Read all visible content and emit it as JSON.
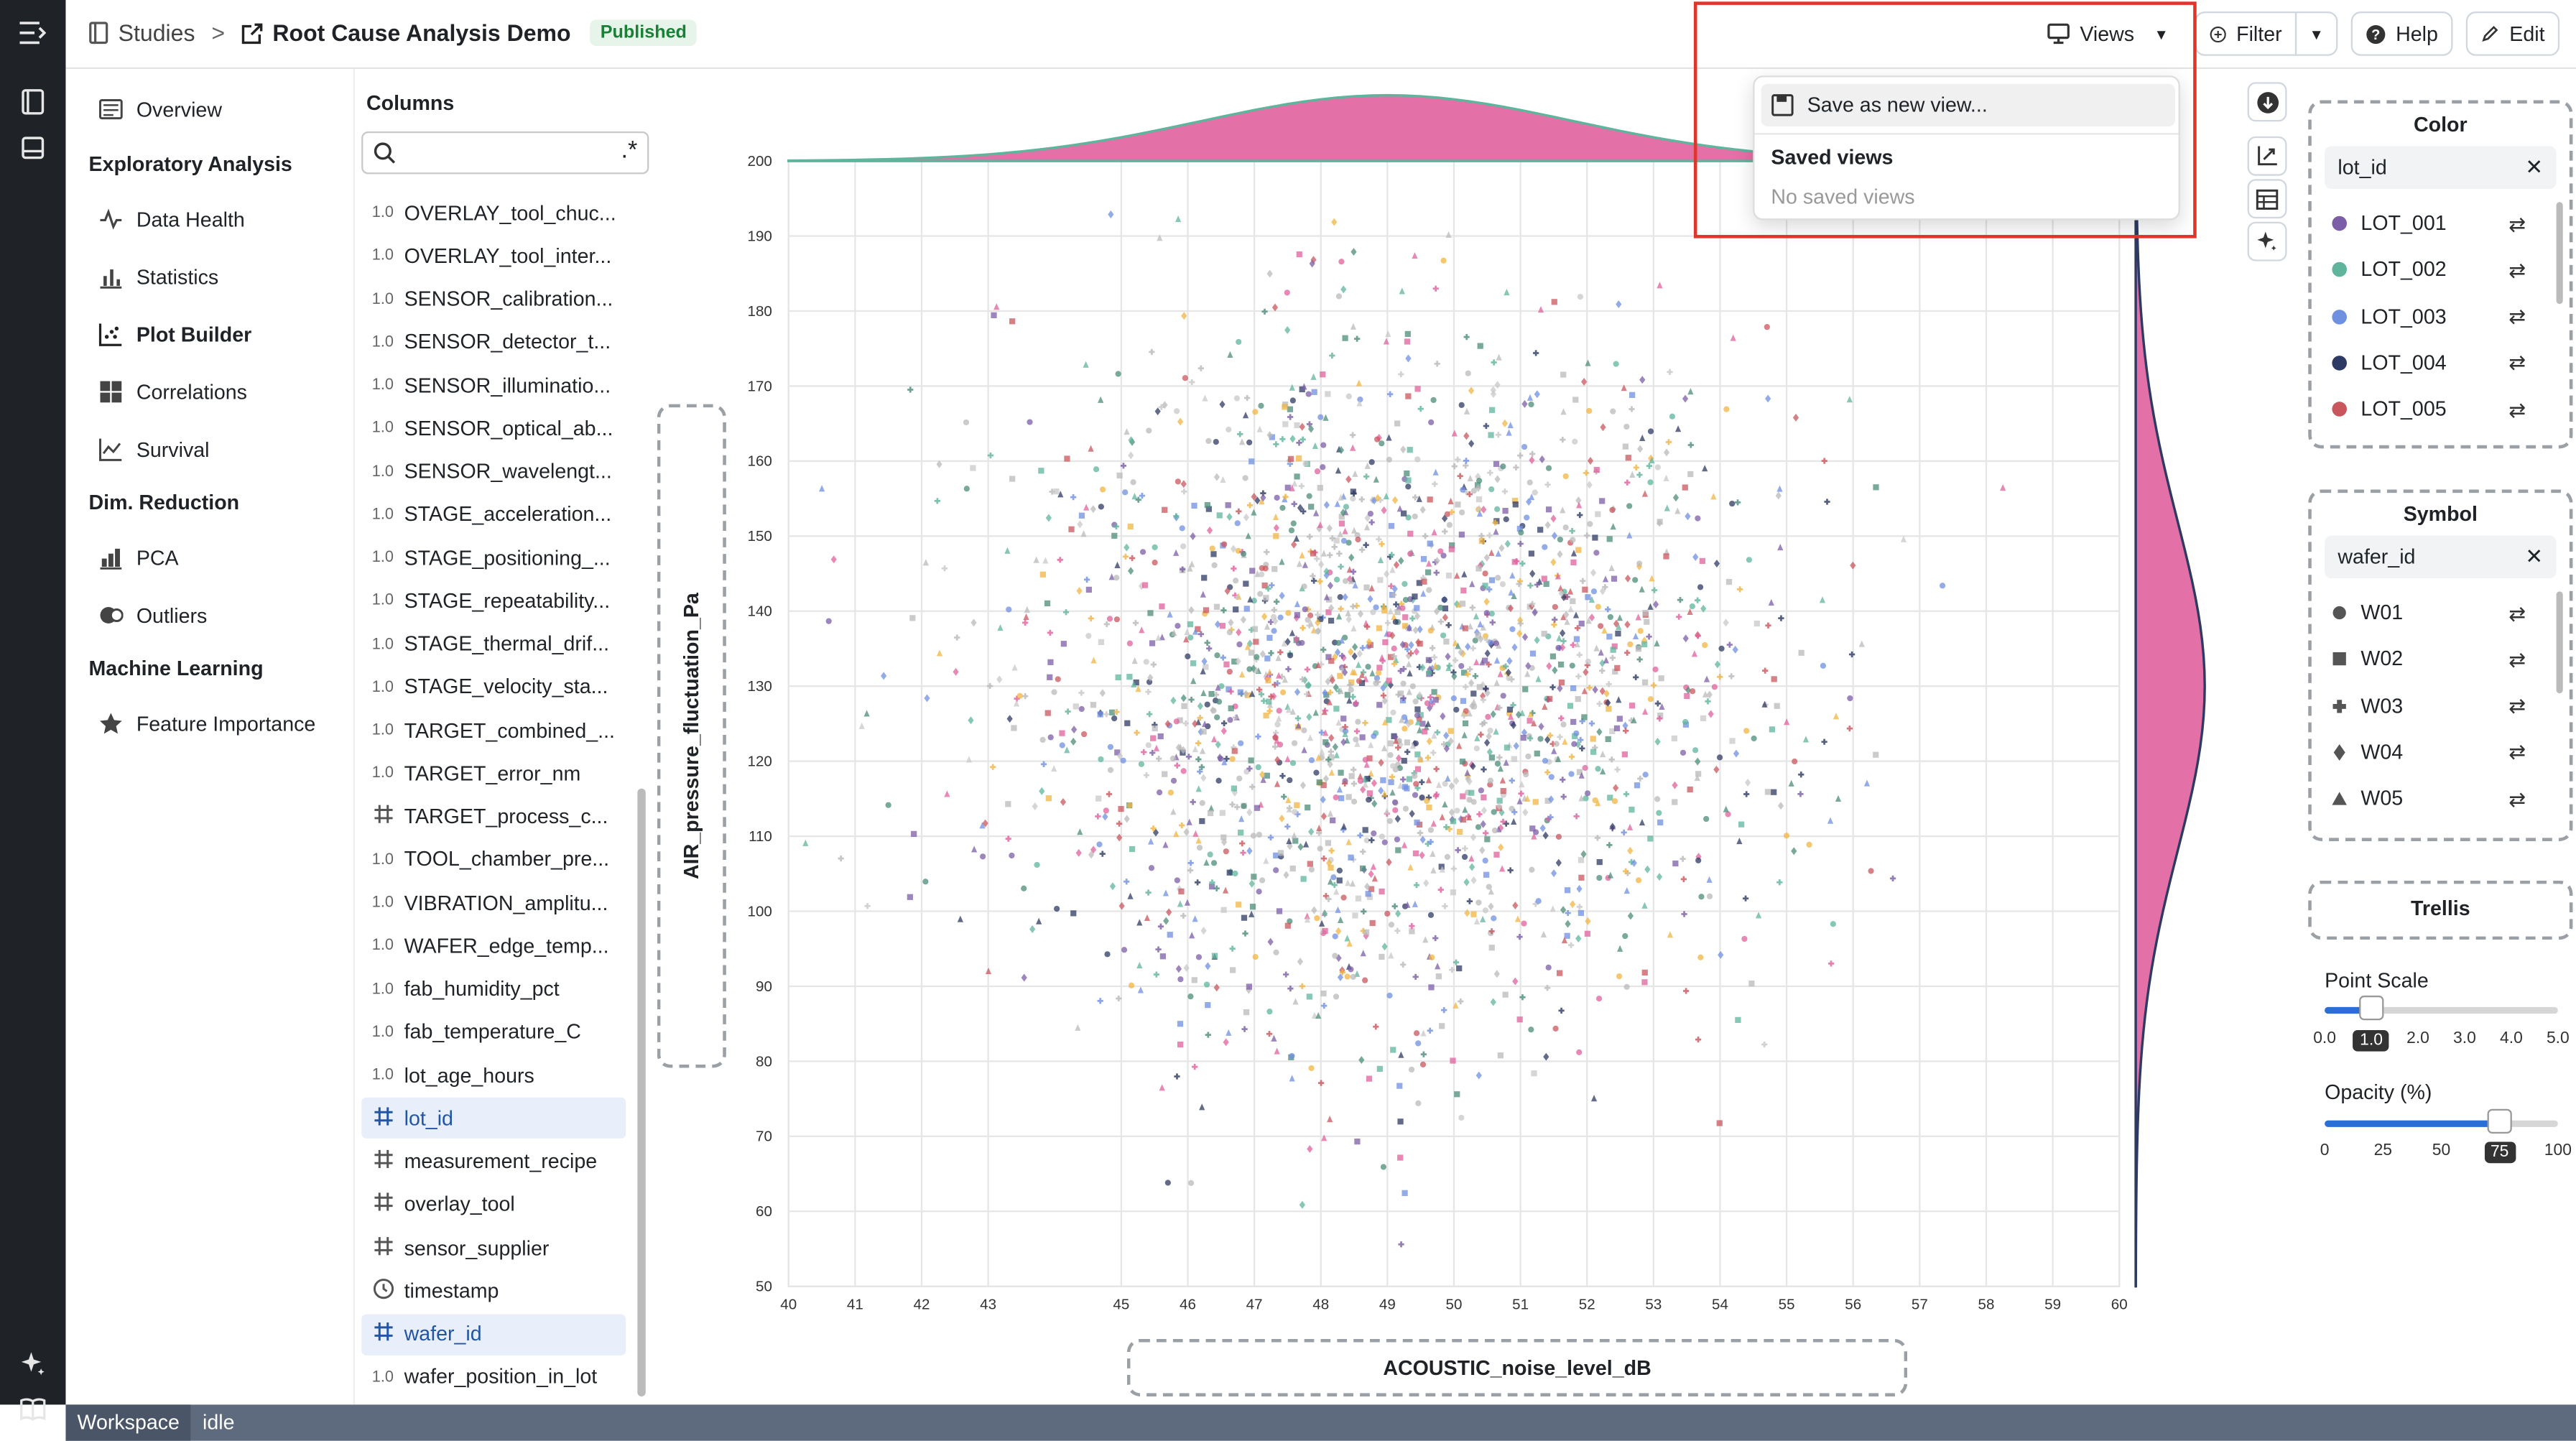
{
  "breadcrumb": {
    "studies": "Studies",
    "separator": ">",
    "title": "Root Cause Analysis Demo",
    "badge": "Published"
  },
  "toolbar": {
    "views": "Views",
    "filter": "Filter",
    "help": "Help",
    "edit": "Edit"
  },
  "views_menu": {
    "save_new": "Save as new view...",
    "saved_header": "Saved views",
    "empty": "No saved views"
  },
  "nav": {
    "overview": "Overview",
    "sec_exploratory": "Exploratory Analysis",
    "data_health": "Data Health",
    "statistics": "Statistics",
    "plot_builder": "Plot Builder",
    "correlations": "Correlations",
    "survival": "Survival",
    "sec_dim": "Dim. Reduction",
    "pca": "PCA",
    "outliers": "Outliers",
    "sec_ml": "Machine Learning",
    "feature_importance": "Feature Importance"
  },
  "columns": {
    "title": "Columns",
    "search_placeholder": "",
    "items": [
      {
        "type": "1.0",
        "label": "OVERLAY_tool_chuc..."
      },
      {
        "type": "1.0",
        "label": "OVERLAY_tool_inter..."
      },
      {
        "type": "1.0",
        "label": "SENSOR_calibration..."
      },
      {
        "type": "1.0",
        "label": "SENSOR_detector_t..."
      },
      {
        "type": "1.0",
        "label": "SENSOR_illuminatio..."
      },
      {
        "type": "1.0",
        "label": "SENSOR_optical_ab..."
      },
      {
        "type": "1.0",
        "label": "SENSOR_wavelengt..."
      },
      {
        "type": "1.0",
        "label": "STAGE_acceleration..."
      },
      {
        "type": "1.0",
        "label": "STAGE_positioning_..."
      },
      {
        "type": "1.0",
        "label": "STAGE_repeatability..."
      },
      {
        "type": "1.0",
        "label": "STAGE_thermal_drif..."
      },
      {
        "type": "1.0",
        "label": "STAGE_velocity_sta..."
      },
      {
        "type": "1.0",
        "label": "TARGET_combined_..."
      },
      {
        "type": "1.0",
        "label": "TARGET_error_nm"
      },
      {
        "type": "cat",
        "label": "TARGET_process_c..."
      },
      {
        "type": "1.0",
        "label": "TOOL_chamber_pre..."
      },
      {
        "type": "1.0",
        "label": "VIBRATION_amplitu..."
      },
      {
        "type": "1.0",
        "label": "WAFER_edge_temp..."
      },
      {
        "type": "1.0",
        "label": "fab_humidity_pct"
      },
      {
        "type": "1.0",
        "label": "fab_temperature_C"
      },
      {
        "type": "1.0",
        "label": "lot_age_hours"
      },
      {
        "type": "cat",
        "label": "lot_id",
        "selected": true
      },
      {
        "type": "cat",
        "label": "measurement_recipe"
      },
      {
        "type": "cat",
        "label": "overlay_tool"
      },
      {
        "type": "cat",
        "label": "sensor_supplier"
      },
      {
        "type": "time",
        "label": "timestamp"
      },
      {
        "type": "cat",
        "label": "wafer_id",
        "selected": true
      },
      {
        "type": "1.0",
        "label": "wafer_position_in_lot"
      }
    ]
  },
  "axes": {
    "x_label": "ACOUSTIC_noise_level_dB",
    "y_label": "AIR_pressure_fluctuation_Pa"
  },
  "chart_data": {
    "type": "scatter",
    "x_ticks": [
      40,
      41,
      42,
      43,
      45,
      46,
      47,
      48,
      49,
      50,
      51,
      52,
      53,
      54,
      55,
      56,
      57,
      58,
      59,
      60
    ],
    "y_ticks": [
      50,
      60,
      70,
      80,
      90,
      100,
      110,
      120,
      130,
      140,
      150,
      160,
      170,
      180,
      190,
      200
    ],
    "xlim": [
      40,
      60
    ],
    "ylim": [
      50,
      200
    ],
    "x_mean": 49,
    "y_mean": 130,
    "grid": true,
    "marginal_top": "density",
    "marginal_right": "density"
  },
  "color_panel": {
    "title": "Color",
    "field": "lot_id",
    "items": [
      {
        "label": "LOT_001",
        "color": "#7b5ea7"
      },
      {
        "label": "LOT_002",
        "color": "#5fb49c"
      },
      {
        "label": "LOT_003",
        "color": "#6f8fe0"
      },
      {
        "label": "LOT_004",
        "color": "#2d3a63"
      },
      {
        "label": "LOT_005",
        "color": "#c9565d"
      }
    ]
  },
  "symbol_panel": {
    "title": "Symbol",
    "field": "wafer_id",
    "items": [
      {
        "label": "W01",
        "symbol": "circle"
      },
      {
        "label": "W02",
        "symbol": "square"
      },
      {
        "label": "W03",
        "symbol": "cross"
      },
      {
        "label": "W04",
        "symbol": "diamond"
      },
      {
        "label": "W05",
        "symbol": "triangle"
      }
    ]
  },
  "trellis": {
    "title": "Trellis"
  },
  "point_scale": {
    "label": "Point Scale",
    "ticks": [
      "0.0",
      "1.0",
      "2.0",
      "3.0",
      "4.0",
      "5.0"
    ],
    "value": 1.0
  },
  "opacity": {
    "label": "Opacity (%)",
    "ticks": [
      "0",
      "25",
      "50",
      "75",
      "100"
    ],
    "value": 75
  },
  "status": {
    "workspace": "Workspace",
    "state": "idle"
  }
}
